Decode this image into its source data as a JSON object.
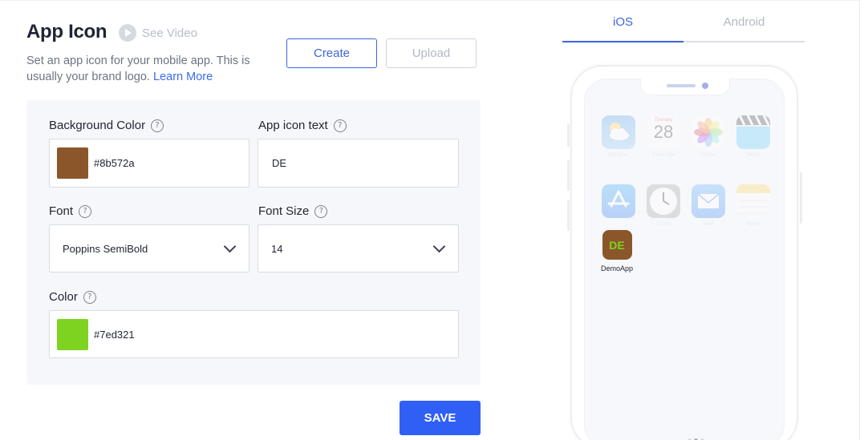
{
  "header": {
    "title": "App Icon",
    "see_video": "See Video",
    "subtitle": "Set an app icon for your mobile app. This is usually your brand logo.",
    "learn_more": "Learn More"
  },
  "actions": {
    "create": "Create",
    "upload": "Upload",
    "save": "SAVE"
  },
  "form": {
    "background_color": {
      "label": "Background Color",
      "value": "#8b572a",
      "swatch": "#8b572a"
    },
    "app_icon_text": {
      "label": "App icon text",
      "value": "DE"
    },
    "font": {
      "label": "Font",
      "value": "Poppins SemiBold"
    },
    "font_size": {
      "label": "Font Size",
      "value": "14"
    },
    "color": {
      "label": "Color",
      "value": "#7ed321",
      "swatch": "#7ed321"
    },
    "help_glyph": "?"
  },
  "preview": {
    "tabs": [
      {
        "label": "iOS",
        "active": true
      },
      {
        "label": "Android",
        "active": false
      }
    ],
    "apps": [
      {
        "label": "Weather",
        "icon": "weather-icon"
      },
      {
        "label": "Calendar",
        "icon": "calendar-icon",
        "day_name": "Tuesday",
        "day": "28"
      },
      {
        "label": "Photo",
        "icon": "photos-icon"
      },
      {
        "label": "Video",
        "icon": "video-icon"
      },
      {
        "label": "",
        "icon": "app-store-icon"
      },
      {
        "label": "Clock",
        "icon": "clock-icon"
      },
      {
        "label": "Mail",
        "icon": "mail-icon"
      },
      {
        "label": "Notes",
        "icon": "notes-icon"
      }
    ],
    "demo_app": {
      "icon_text": "DE",
      "label": "DemoApp",
      "bg": "#8b572a",
      "fg": "#7ed321"
    }
  },
  "colors": {
    "accent": "#2f5ff5",
    "link": "#3a6cf0",
    "panel_bg": "#f6f7fa"
  }
}
